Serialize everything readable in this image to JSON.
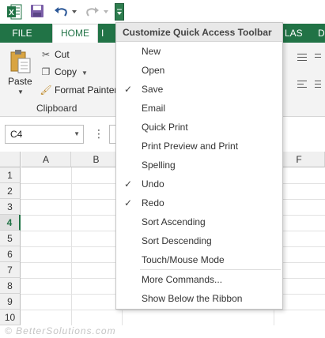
{
  "tabs": {
    "file": "FILE",
    "home": "HOME",
    "partial_left": "I",
    "partial_right": "LAS",
    "partial_far": "D"
  },
  "clipboard": {
    "paste": "Paste",
    "cut": "Cut",
    "copy": "Copy",
    "format_painter": "Format Painter",
    "group_label": "Clipboard"
  },
  "formula_bar": {
    "name_box": "C4"
  },
  "grid": {
    "columns": [
      "A",
      "B",
      "",
      "",
      "",
      "F"
    ],
    "rows": [
      "1",
      "2",
      "3",
      "4",
      "5",
      "6",
      "7",
      "8",
      "9",
      "10"
    ],
    "active_row": "4"
  },
  "menu": {
    "title": "Customize Quick Access Toolbar",
    "items": [
      {
        "label": "New",
        "checked": false
      },
      {
        "label": "Open",
        "checked": false
      },
      {
        "label": "Save",
        "checked": true
      },
      {
        "label": "Email",
        "checked": false
      },
      {
        "label": "Quick Print",
        "checked": false
      },
      {
        "label": "Print Preview and Print",
        "checked": false
      },
      {
        "label": "Spelling",
        "checked": false
      },
      {
        "label": "Undo",
        "checked": true
      },
      {
        "label": "Redo",
        "checked": true
      },
      {
        "label": "Sort Ascending",
        "checked": false
      },
      {
        "label": "Sort Descending",
        "checked": false
      },
      {
        "label": "Touch/Mouse Mode",
        "checked": false
      }
    ],
    "more_commands": "More Commands...",
    "show_below": "Show Below the Ribbon",
    "check_glyph": "✓"
  },
  "watermark": "© BetterSolutions.com",
  "colors": {
    "excel_green": "#217346",
    "menu_header_bg": "#e8e8e8"
  }
}
